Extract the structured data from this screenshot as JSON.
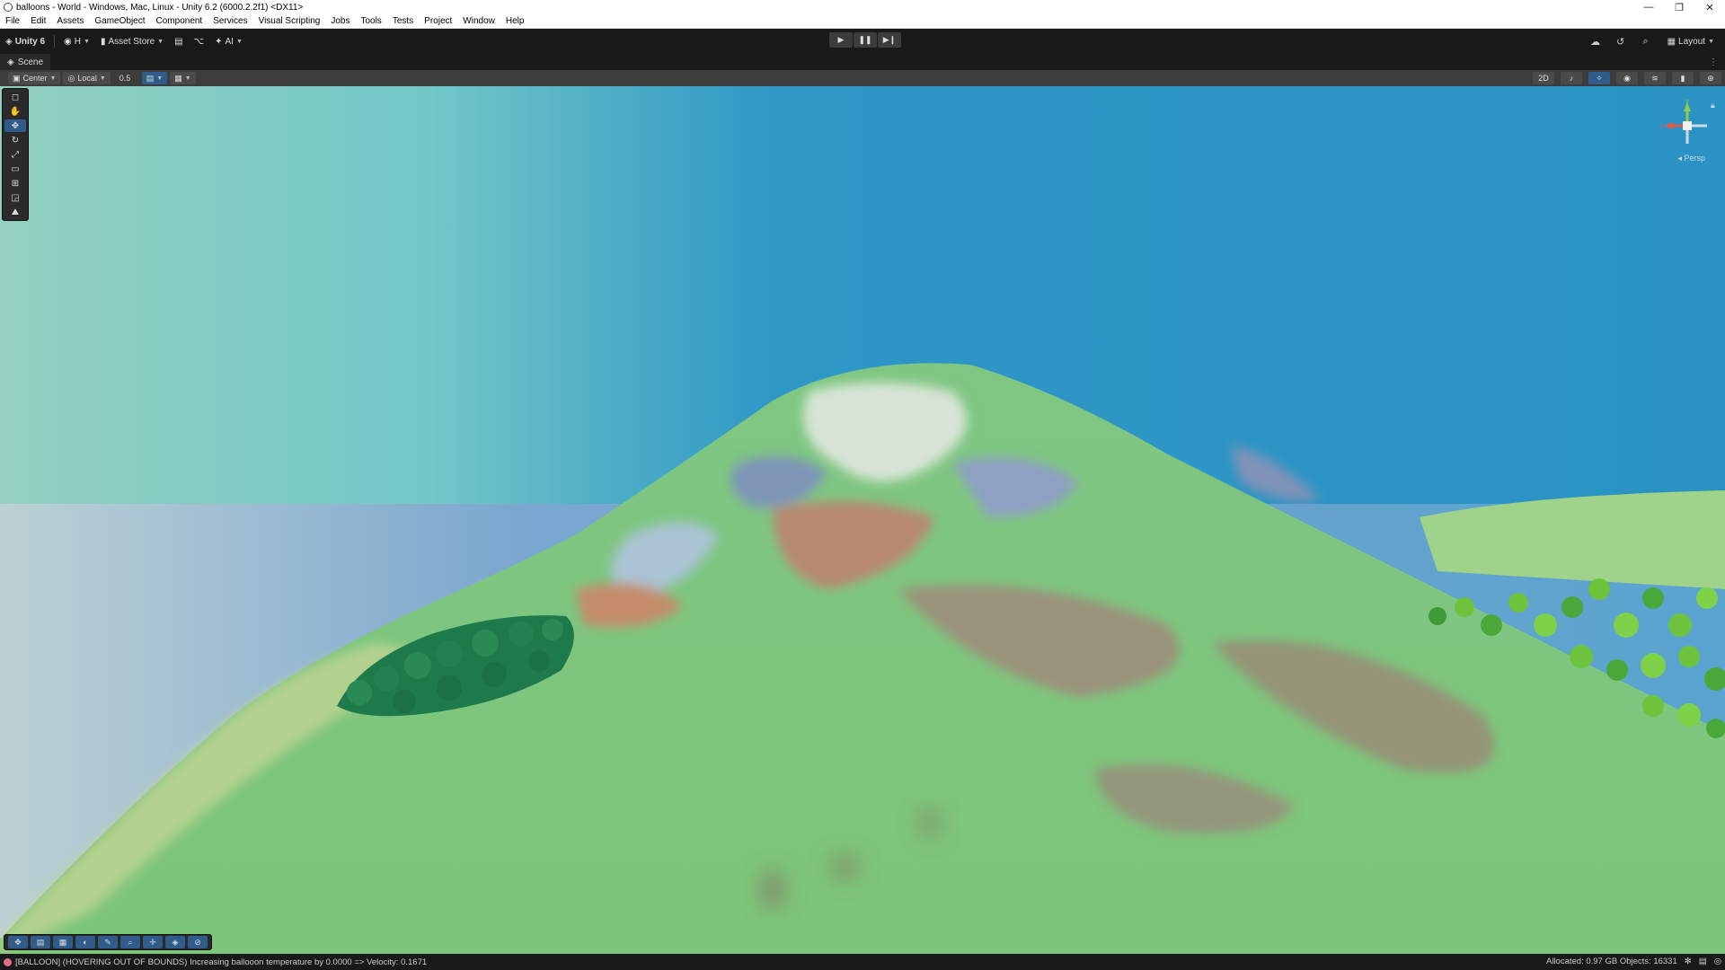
{
  "window": {
    "title": "balloons - World - Windows, Mac, Linux - Unity 6.2 (6000.2.2f1) <DX11>",
    "controls": {
      "minimize": "—",
      "restore": "❐",
      "close": "✕"
    }
  },
  "menu": [
    "File",
    "Edit",
    "Assets",
    "GameObject",
    "Component",
    "Services",
    "Visual Scripting",
    "Jobs",
    "Tools",
    "Tests",
    "Project",
    "Window",
    "Help"
  ],
  "toolbar": {
    "unity_label": "Unity 6",
    "account_label": "H",
    "asset_store_label": "Asset Store",
    "ai_label": "AI",
    "layout_label": "Layout"
  },
  "scene": {
    "tab_label": "Scene",
    "pivot_label": "Center",
    "space_label": "Local",
    "snap_value": "0.5",
    "projection_label": "Persp"
  },
  "gizmo_axes": {
    "x": "x",
    "y": "y"
  },
  "status": {
    "message": "[BALLOON] (HOVERING OUT OF BOUNDS) Increasing ballooon temperature by 0.0000 => Velocity: 0.1671",
    "memory": "Allocated: 0.97 GB Objects: 16331"
  },
  "colors": {
    "sky": "#2a93c4",
    "hill": "#7fc57e",
    "forest": "#1e7a4a",
    "trees": "#6dc43c"
  }
}
